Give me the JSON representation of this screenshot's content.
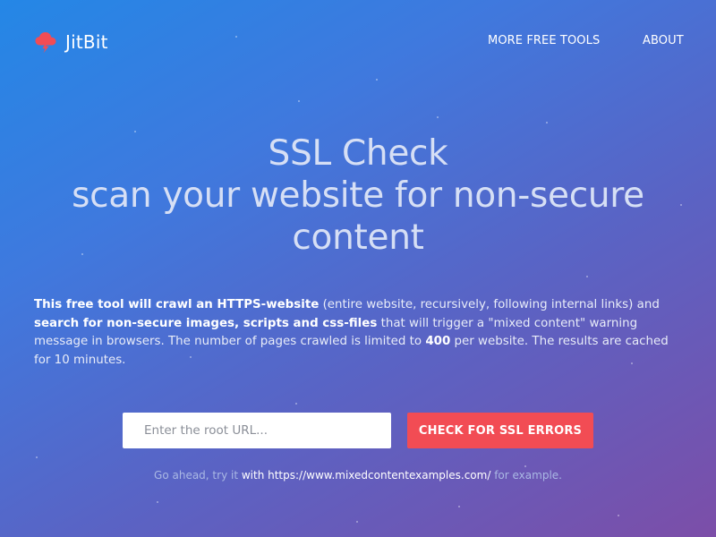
{
  "brand": {
    "name": "JitBit",
    "icon": "cloud-lightning-icon",
    "icon_color": "#f24c54"
  },
  "nav": {
    "more_tools": "MORE FREE TOOLS",
    "about": "ABOUT"
  },
  "hero": {
    "title_line1": "SSL Check",
    "title_line2": "scan your website for non-secure content"
  },
  "description": {
    "part1_bold": "This free tool will crawl an HTTPS-website",
    "part2": " (entire website, recursively, following internal links) and ",
    "part3_bold": "search for non-secure images, scripts and css-files",
    "part4": " that will trigger a \"mixed content\" warning message in browsers. The number of pages crawled is limited to ",
    "limit_bold": "400",
    "part5": " per website. The results are cached for 10 minutes."
  },
  "form": {
    "url_placeholder": "Enter the root URL...",
    "url_value": "",
    "submit_label": "CHECK FOR SSL ERRORS"
  },
  "example": {
    "prefix": "Go ahead, try it ",
    "link_text": "with https://www.mixedcontentexamples.com/",
    "suffix": " for example."
  },
  "colors": {
    "background_start": "#2487e6",
    "background_end": "#7c4ea8",
    "button": "#f24c54",
    "title_text": "#d6dff5"
  }
}
